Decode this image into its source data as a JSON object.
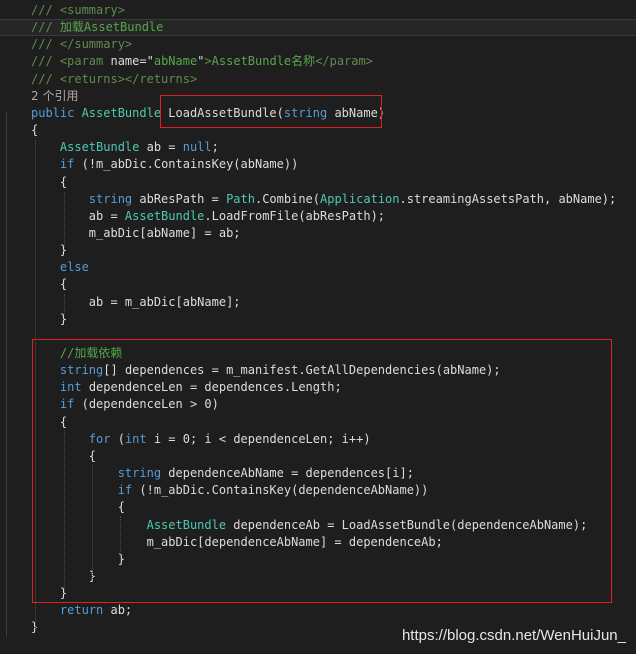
{
  "colors": {
    "background": "#1e1e1e",
    "comment": "#57a64a",
    "keyword": "#569cd6",
    "type": "#4ec9b0",
    "highlight_box": "#e02020"
  },
  "lines": [
    {
      "tokens": [
        {
          "c": "d",
          "t": "/// "
        },
        {
          "c": "d",
          "t": "<summary>"
        }
      ]
    },
    {
      "current": true,
      "tokens": [
        {
          "c": "d",
          "t": "/// "
        },
        {
          "c": "c",
          "t": "加载AssetBundle"
        }
      ]
    },
    {
      "tokens": [
        {
          "c": "d",
          "t": "/// "
        },
        {
          "c": "d",
          "t": "</summary>"
        }
      ]
    },
    {
      "tokens": [
        {
          "c": "d",
          "t": "/// "
        },
        {
          "c": "d",
          "t": "<param "
        },
        {
          "c": "p",
          "t": "name=\""
        },
        {
          "c": "c",
          "t": "abName"
        },
        {
          "c": "p",
          "t": "\""
        },
        {
          "c": "d",
          "t": ">"
        },
        {
          "c": "c",
          "t": "AssetBundle名称"
        },
        {
          "c": "d",
          "t": "</param>"
        }
      ]
    },
    {
      "tokens": [
        {
          "c": "d",
          "t": "/// "
        },
        {
          "c": "d",
          "t": "<returns></returns>"
        }
      ]
    },
    {
      "tokens": [
        {
          "c": "r",
          "t": "2 个引用"
        }
      ]
    },
    {
      "tokens": [
        {
          "c": "k",
          "t": "public "
        },
        {
          "c": "t",
          "t": "AssetBundle "
        },
        {
          "c": "p",
          "t": "LoadAssetBundle("
        },
        {
          "c": "k",
          "t": "string "
        },
        {
          "c": "p",
          "t": "abName)"
        }
      ]
    },
    {
      "tokens": [
        {
          "c": "p",
          "t": "{"
        }
      ]
    },
    {
      "tokens": [
        {
          "c": "p",
          "t": "    "
        },
        {
          "c": "t",
          "t": "AssetBundle "
        },
        {
          "c": "p",
          "t": "ab = "
        },
        {
          "c": "k",
          "t": "null"
        },
        {
          "c": "p",
          "t": ";"
        }
      ]
    },
    {
      "tokens": [
        {
          "c": "p",
          "t": "    "
        },
        {
          "c": "k",
          "t": "if "
        },
        {
          "c": "p",
          "t": "(!m_abDic.ContainsKey(abName))"
        }
      ]
    },
    {
      "tokens": [
        {
          "c": "p",
          "t": "    {"
        }
      ]
    },
    {
      "tokens": [
        {
          "c": "p",
          "t": "        "
        },
        {
          "c": "k",
          "t": "string "
        },
        {
          "c": "p",
          "t": "abResPath = "
        },
        {
          "c": "t",
          "t": "Path"
        },
        {
          "c": "p",
          "t": ".Combine("
        },
        {
          "c": "t",
          "t": "Application"
        },
        {
          "c": "p",
          "t": ".streamingAssetsPath, abName);"
        }
      ]
    },
    {
      "tokens": [
        {
          "c": "p",
          "t": "        ab = "
        },
        {
          "c": "t",
          "t": "AssetBundle"
        },
        {
          "c": "p",
          "t": ".LoadFromFile(abResPath);"
        }
      ]
    },
    {
      "tokens": [
        {
          "c": "p",
          "t": "        m_abDic[abName] = ab;"
        }
      ]
    },
    {
      "tokens": [
        {
          "c": "p",
          "t": "    }"
        }
      ]
    },
    {
      "tokens": [
        {
          "c": "p",
          "t": "    "
        },
        {
          "c": "k",
          "t": "else"
        }
      ]
    },
    {
      "tokens": [
        {
          "c": "p",
          "t": "    {"
        }
      ]
    },
    {
      "tokens": [
        {
          "c": "p",
          "t": "        ab = m_abDic[abName];"
        }
      ]
    },
    {
      "tokens": [
        {
          "c": "p",
          "t": "    }"
        }
      ]
    },
    {
      "tokens": [
        {
          "c": "p",
          "t": ""
        }
      ]
    },
    {
      "tokens": [
        {
          "c": "p",
          "t": "    "
        },
        {
          "c": "c",
          "t": "//加载依赖"
        }
      ]
    },
    {
      "tokens": [
        {
          "c": "p",
          "t": "    "
        },
        {
          "c": "k",
          "t": "string"
        },
        {
          "c": "p",
          "t": "[] dependences = m_manifest.GetAllDependencies(abName);"
        }
      ]
    },
    {
      "tokens": [
        {
          "c": "p",
          "t": "    "
        },
        {
          "c": "k",
          "t": "int "
        },
        {
          "c": "p",
          "t": "dependenceLen = dependences.Length;"
        }
      ]
    },
    {
      "tokens": [
        {
          "c": "p",
          "t": "    "
        },
        {
          "c": "k",
          "t": "if "
        },
        {
          "c": "p",
          "t": "(dependenceLen > 0)"
        }
      ]
    },
    {
      "tokens": [
        {
          "c": "p",
          "t": "    {"
        }
      ]
    },
    {
      "tokens": [
        {
          "c": "p",
          "t": "        "
        },
        {
          "c": "k",
          "t": "for "
        },
        {
          "c": "p",
          "t": "("
        },
        {
          "c": "k",
          "t": "int "
        },
        {
          "c": "p",
          "t": "i = 0; i < dependenceLen; i++)"
        }
      ]
    },
    {
      "tokens": [
        {
          "c": "p",
          "t": "        {"
        }
      ]
    },
    {
      "tokens": [
        {
          "c": "p",
          "t": "            "
        },
        {
          "c": "k",
          "t": "string "
        },
        {
          "c": "p",
          "t": "dependenceAbName = dependences[i];"
        }
      ]
    },
    {
      "tokens": [
        {
          "c": "p",
          "t": "            "
        },
        {
          "c": "k",
          "t": "if "
        },
        {
          "c": "p",
          "t": "(!m_abDic.ContainsKey(dependenceAbName))"
        }
      ]
    },
    {
      "tokens": [
        {
          "c": "p",
          "t": "            {"
        }
      ]
    },
    {
      "tokens": [
        {
          "c": "p",
          "t": "                "
        },
        {
          "c": "t",
          "t": "AssetBundle "
        },
        {
          "c": "p",
          "t": "dependenceAb = LoadAssetBundle(dependenceAbName);"
        }
      ]
    },
    {
      "tokens": [
        {
          "c": "p",
          "t": "                m_abDic[dependenceAbName] = dependenceAb;"
        }
      ]
    },
    {
      "tokens": [
        {
          "c": "p",
          "t": "            }"
        }
      ]
    },
    {
      "tokens": [
        {
          "c": "p",
          "t": "        }"
        }
      ]
    },
    {
      "tokens": [
        {
          "c": "p",
          "t": "    }"
        }
      ]
    },
    {
      "tokens": [
        {
          "c": "p",
          "t": "    "
        },
        {
          "c": "k",
          "t": "return "
        },
        {
          "c": "p",
          "t": "ab;"
        }
      ]
    },
    {
      "tokens": [
        {
          "c": "p",
          "t": "}"
        }
      ]
    }
  ],
  "watermark": "https://blog.csdn.net/WenHuiJun_"
}
